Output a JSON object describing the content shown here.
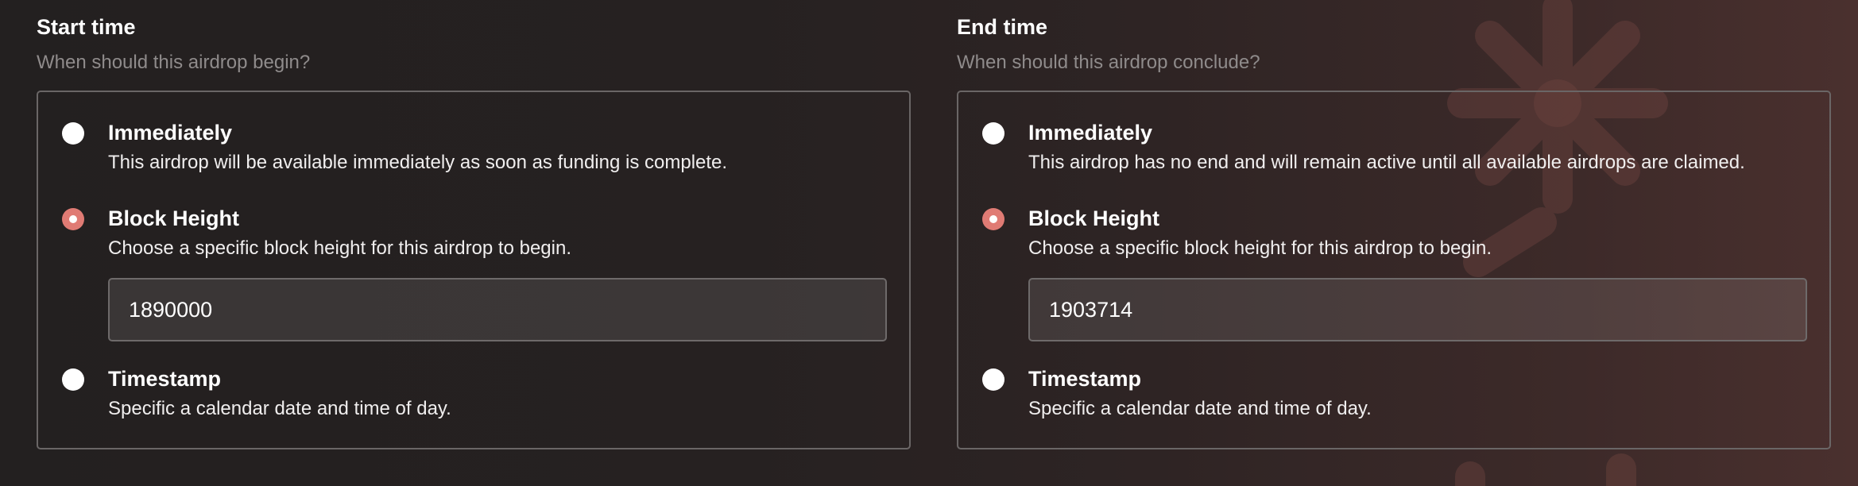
{
  "start_time": {
    "title": "Start time",
    "subtitle": "When should this airdrop begin?",
    "selected": "block_height",
    "options": [
      {
        "key": "immediately",
        "label": "Immediately",
        "description": "This airdrop will be available immediately as soon as funding is complete."
      },
      {
        "key": "block_height",
        "label": "Block Height",
        "description": "Choose a specific block height for this airdrop to begin."
      },
      {
        "key": "timestamp",
        "label": "Timestamp",
        "description": "Specific a calendar date and time of day."
      }
    ],
    "block_height_value": "1890000"
  },
  "end_time": {
    "title": "End time",
    "subtitle": "When should this airdrop conclude?",
    "selected": "block_height",
    "options": [
      {
        "key": "immediately",
        "label": "Immediately",
        "description": "This airdrop has no end and will remain active until all available airdrops are claimed."
      },
      {
        "key": "block_height",
        "label": "Block Height",
        "description": "Choose a specific block height for this airdrop to begin."
      },
      {
        "key": "timestamp",
        "label": "Timestamp",
        "description": "Specific a calendar date and time of day."
      }
    ],
    "block_height_value": "1903714"
  },
  "colors": {
    "accent": "#e07b74",
    "border": "#6a6666",
    "subtitle": "#8f8b8b"
  }
}
